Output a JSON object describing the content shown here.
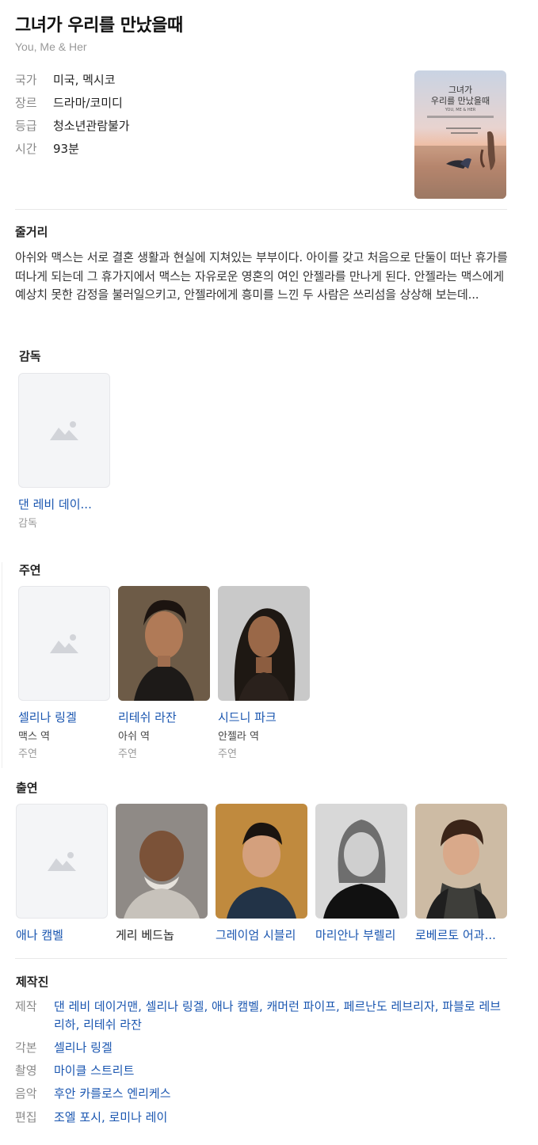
{
  "movie": {
    "title": "그녀가 우리를 만났을때",
    "original_title": "You, Me & Her"
  },
  "info": [
    {
      "key": "국가",
      "value": "미국, 멕시코"
    },
    {
      "key": "장르",
      "value": "드라마/코미디"
    },
    {
      "key": "등급",
      "value": "청소년관람불가"
    },
    {
      "key": "시간",
      "value": "93분"
    }
  ],
  "poster": {
    "title_line1": "그녀가",
    "title_line2": "우리를 만났을때",
    "subtitle": "YOU, ME & HER"
  },
  "synopsis": {
    "heading": "줄거리",
    "text": "아쉬와 맥스는 서로 결혼 생활과 현실에 지쳐있는 부부이다. 아이를 갖고 처음으로 단둘이 떠난 휴가를 떠나게 되는데 그 휴가지에서 맥스는 자유로운 영혼의 여인 안젤라를 만나게 된다. 안젤라는 맥스에게 예상치 못한 감정을 불러일으키고, 안젤라에게 흥미를 느낀 두 사람은 쓰리섬을 상상해 보는데..."
  },
  "director": {
    "heading": "감독",
    "people": [
      {
        "name": "댄 레비 데이...",
        "kind": "감독"
      }
    ]
  },
  "lead": {
    "heading": "주연",
    "people": [
      {
        "name": "셀리나 링겔",
        "role": "맥스 역",
        "kind": "주연"
      },
      {
        "name": "리테쉬 라잔",
        "role": "아쉬 역",
        "kind": "주연"
      },
      {
        "name": "시드니 파크",
        "role": "안젤라 역",
        "kind": "주연"
      }
    ]
  },
  "supporting": {
    "heading": "출연",
    "people": [
      {
        "name": "애나 캠벨"
      },
      {
        "name": "게리 베드놉"
      },
      {
        "name": "그레이엄 시블리"
      },
      {
        "name": "마리안나 부렐리"
      },
      {
        "name": "로베르토 어과..."
      }
    ]
  },
  "crew": {
    "heading": "제작진",
    "rows": [
      {
        "key": "제작",
        "value": "댄 레비 데이거맨, 셀리나 링겔, 애나 캠벨, 캐머런 파이프, 페르난도 레브리자, 파블로 레브리하, 리테쉬 라잔"
      },
      {
        "key": "각본",
        "value": "셀리나 링겔"
      },
      {
        "key": "촬영",
        "value": "마이클 스트리트"
      },
      {
        "key": "음악",
        "value": "후안 카를로스 엔리케스"
      },
      {
        "key": "편집",
        "value": "조엘 포시, 로미나 레이"
      }
    ]
  },
  "colors": {
    "link": "#1a56b0",
    "muted": "#888888",
    "placeholder_bg": "#f4f5f7"
  }
}
